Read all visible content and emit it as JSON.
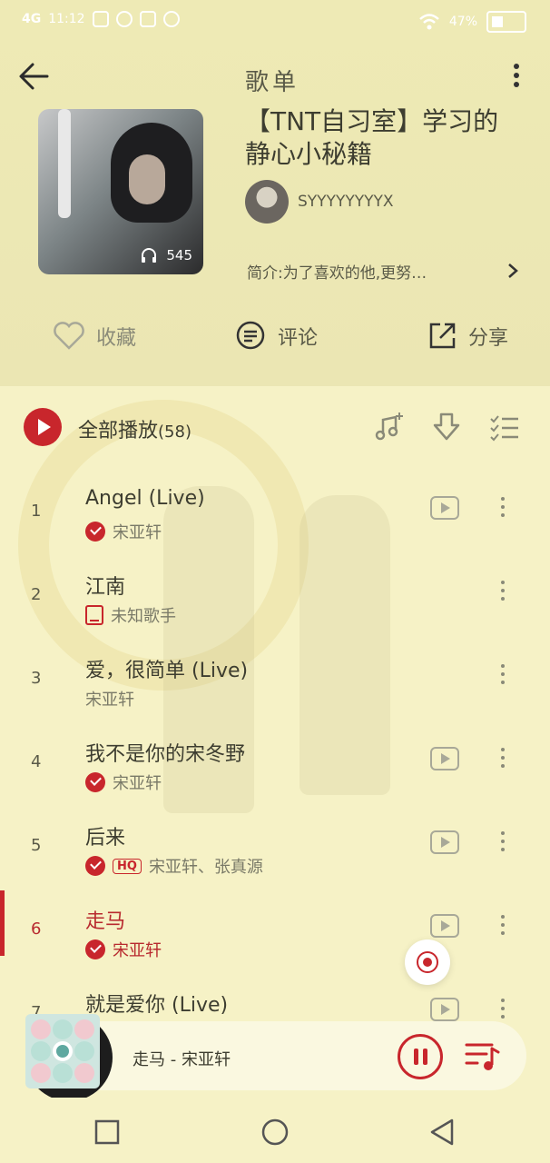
{
  "status_bar": {
    "network": "4G",
    "time": "11:12",
    "battery": "47%"
  },
  "header": {
    "title": "歌单"
  },
  "playlist": {
    "name": "【TNT自习室】学习的静心小秘籍",
    "play_count": "545",
    "owner": "SYYYYYYYYX",
    "intro": "简介:为了喜欢的他,更努…"
  },
  "actions": {
    "favorite": "收藏",
    "comment": "评论",
    "share": "分享"
  },
  "list_header": {
    "play_all_label": "全部播放",
    "count": "(58)"
  },
  "songs": [
    {
      "num": "1",
      "title": "Angel (Live)",
      "artist": "宋亚轩"
    },
    {
      "num": "2",
      "title": "江南",
      "artist": "未知歌手"
    },
    {
      "num": "3",
      "title": "爱，很简单 (Live)",
      "artist": "宋亚轩"
    },
    {
      "num": "4",
      "title": "我不是你的宋冬野",
      "artist": "宋亚轩"
    },
    {
      "num": "5",
      "title": "后来",
      "artist": "宋亚轩、张真源",
      "badge": "HQ"
    },
    {
      "num": "6",
      "title": "走马",
      "artist": "宋亚轩"
    },
    {
      "num": "7",
      "title": "就是爱你 (Live)",
      "artist": ""
    }
  ],
  "mini_player": {
    "now_playing": "走马 - 宋亚轩"
  },
  "colors": {
    "accent": "#c8262c",
    "header_bg": "#eeeab5",
    "list_bg": "#f6f2c6"
  }
}
